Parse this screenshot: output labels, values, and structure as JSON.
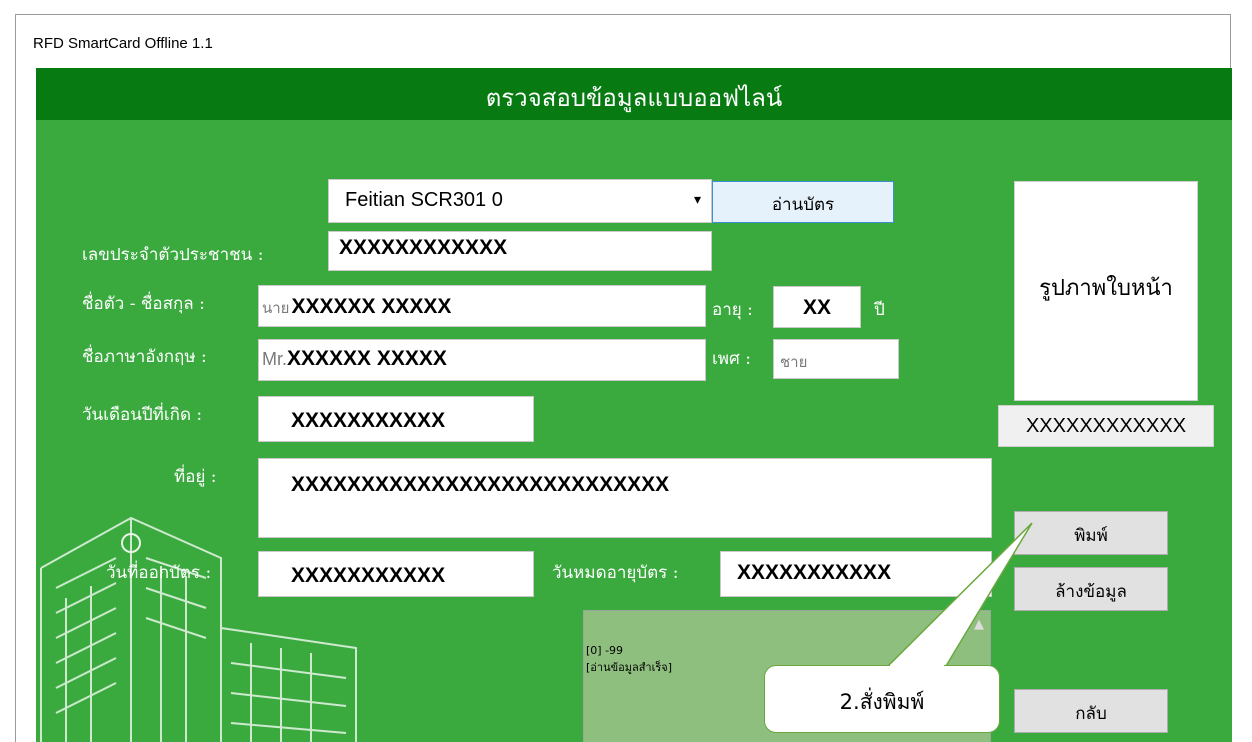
{
  "window": {
    "title": "RFD SmartCard Offline 1.1"
  },
  "header": {
    "title": "ตรวจสอบข้อมูลแบบออฟไลน์"
  },
  "reader": {
    "selected": "Feitian SCR301 0",
    "read_button": "อ่านบัตร"
  },
  "form": {
    "citizen_id": {
      "label": "เลขประจำตัวประชาชน :",
      "value": "XXXXXXXXXXXX"
    },
    "name_th": {
      "label": "ชื่อตัว - ชื่อสกุล :",
      "prefix": "นาย",
      "value": "XXXXXX XXXXX"
    },
    "age": {
      "label": "อายุ :",
      "value": "XX",
      "unit": "ปี"
    },
    "name_en": {
      "label": "ชื่อภาษาอังกฤษ :",
      "prefix": "Mr.",
      "value": "XXXXXX XXXXX"
    },
    "sex": {
      "label": "เพศ :",
      "value": "ชาย"
    },
    "birth_date": {
      "label": "วันเดือนปีที่เกิด :",
      "value": "XXXXXXXXXXX"
    },
    "address": {
      "label": "ที่อยู่ :",
      "value": "XXXXXXXXXXXXXXXXXXXXXXXXXXX"
    },
    "issue_date": {
      "label": "วันที่ออกบัตร :",
      "value": "XXXXXXXXXXX"
    },
    "expiry_date": {
      "label": "วันหมดอายุบัตร :",
      "value": "XXXXXXXXXXX"
    }
  },
  "photo": {
    "placeholder": "รูปภาพใบหน้า",
    "id_number": "XXXXXXXXXXXX"
  },
  "buttons": {
    "print": "พิมพ์",
    "clear": "ล้างข้อมูล",
    "back": "กลับ"
  },
  "log": {
    "line1": "[0] -99",
    "line2": "[อ่านข้อมูลสำเร็จ]"
  },
  "callout": {
    "text": "2.สั่งพิมพ์"
  },
  "colors": {
    "header": "#077a12",
    "panel": "#3aaa3f",
    "log_bg": "#8fbf7f",
    "callout_border": "#6aa83f"
  }
}
